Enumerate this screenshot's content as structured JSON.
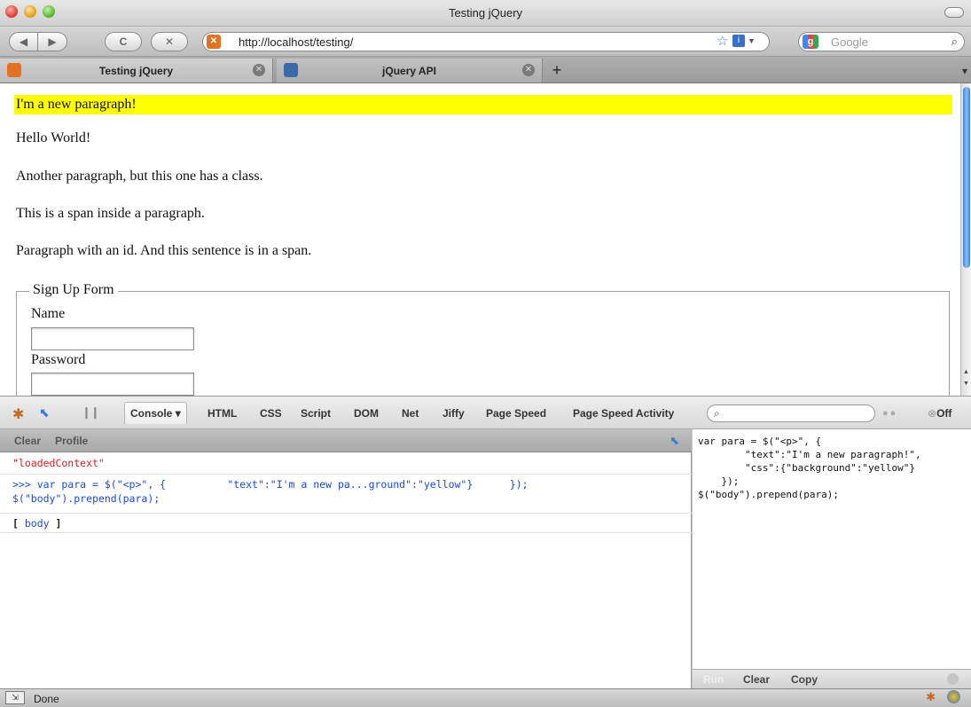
{
  "window": {
    "title": "Testing jQuery"
  },
  "navbar": {
    "url": "http://localhost/testing/",
    "search_placeholder": "Google",
    "back": "◀",
    "forward": "▶",
    "reload": "C",
    "stop": "✕"
  },
  "tabs": [
    {
      "label": "Testing jQuery",
      "close": "✕"
    },
    {
      "label": "jQuery API",
      "close": "✕"
    }
  ],
  "newtab": "+",
  "page": {
    "new_paragraph": "I'm a new paragraph!",
    "p1": "Hello World!",
    "p2": "Another paragraph, but this one has a class.",
    "p3": "This is a span inside a paragraph.",
    "p4": "Paragraph with an id. And this sentence is in a span.",
    "form": {
      "legend": "Sign Up Form",
      "name_label": "Name",
      "password_label": "Password",
      "name_value": "",
      "password_value": ""
    }
  },
  "firebug": {
    "tabs": [
      "Console",
      "HTML",
      "CSS",
      "Script",
      "DOM",
      "Net",
      "Jiffy",
      "Page Speed",
      "Page Speed Activity"
    ],
    "console_arrow": "▾",
    "off_label": "Off",
    "search_value": ""
  },
  "console": {
    "clear": "Clear",
    "profile": "Profile",
    "rows": {
      "loaded": "\"loadedContext\"",
      "command_line1": ">>> var para = $(\"<p>\", {          \"text\":\"I'm a new pa...ground\":\"yellow\"}      });",
      "command_line2": "$(\"body\").prepend(para);",
      "result_open": "[ ",
      "result_body": "body",
      "result_close": " ]"
    }
  },
  "editor": {
    "code": "var para = $(\"<p>\", {\n        \"text\":\"I'm a new paragraph!\",\n        \"css\":{\"background\":\"yellow\"}\n    });\n$(\"body\").prepend(para);",
    "run": "Run",
    "clear": "Clear",
    "copy": "Copy"
  },
  "statusbar": {
    "text": "Done"
  },
  "colors": {
    "highlight": "#ffff00",
    "console_string": "#dd1f1f",
    "console_command": "#1c49d6"
  }
}
